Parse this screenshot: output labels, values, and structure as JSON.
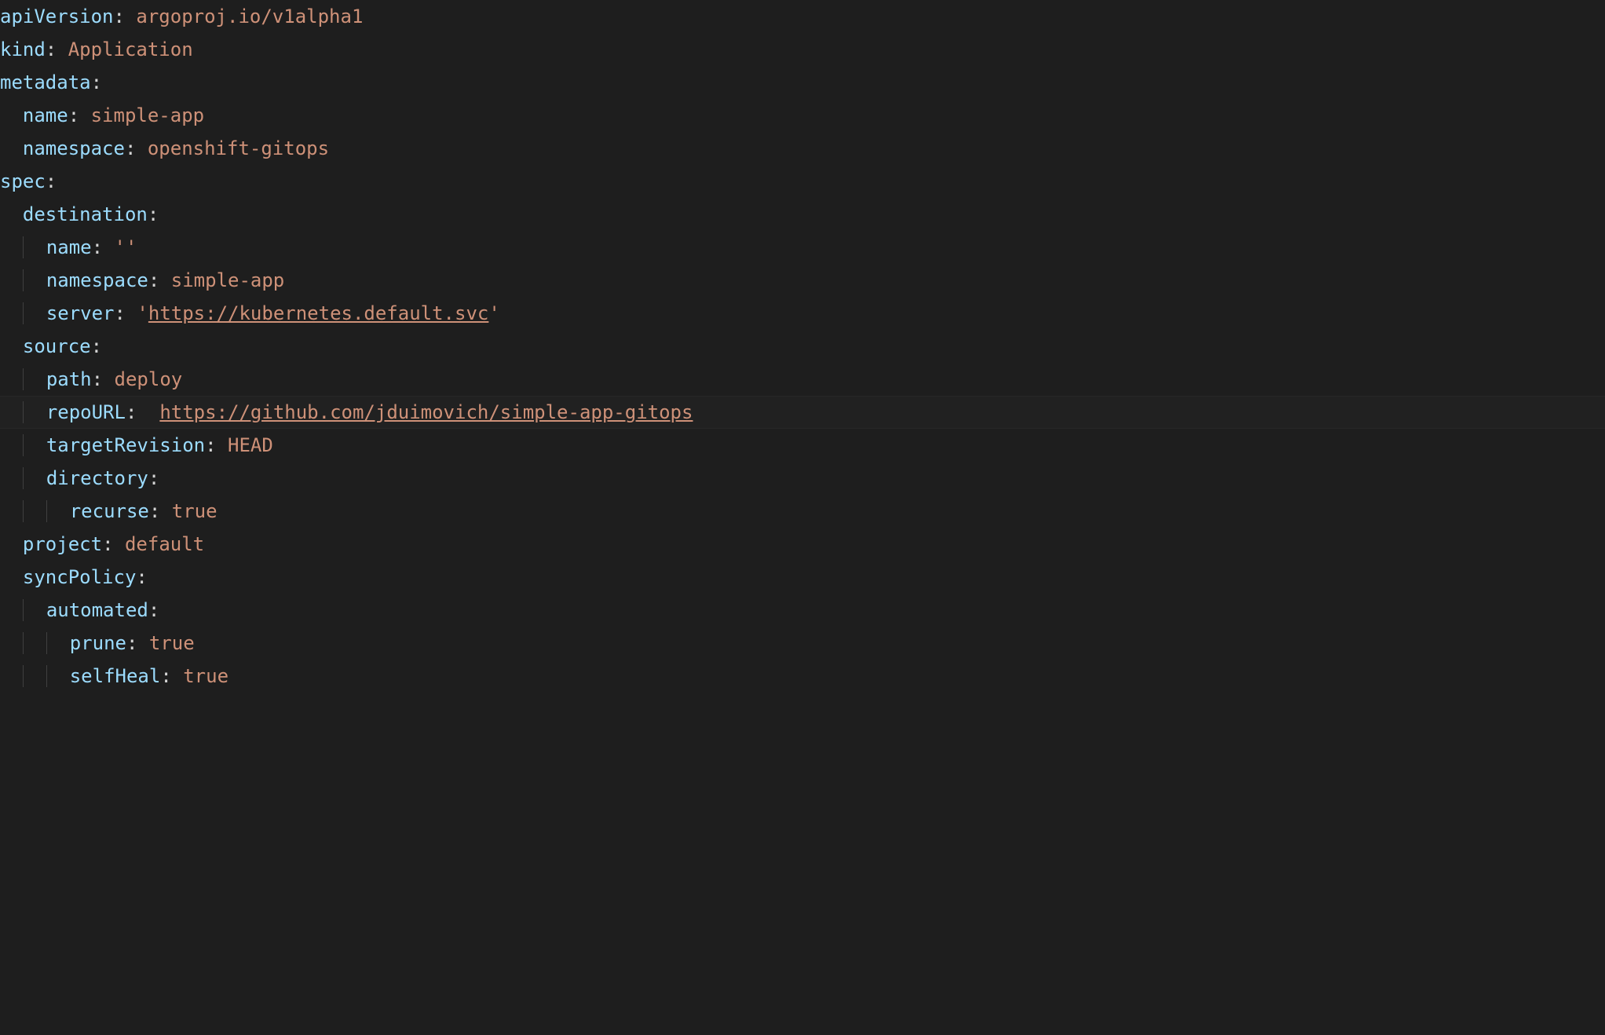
{
  "lines": {
    "l1": {
      "key": "apiVersion",
      "value": "argoproj.io/v1alpha1"
    },
    "l2": {
      "key": "kind",
      "value": "Application"
    },
    "l3": {
      "key": "metadata"
    },
    "l4": {
      "key": "name",
      "value": "simple-app"
    },
    "l5": {
      "key": "namespace",
      "value": "openshift-gitops"
    },
    "l6": {
      "key": "spec"
    },
    "l7": {
      "key": "destination"
    },
    "l8": {
      "key": "name",
      "quote1": "'",
      "value": "",
      "quote2": "'"
    },
    "l9": {
      "key": "namespace",
      "value": "simple-app"
    },
    "l10": {
      "key": "server",
      "quote1": "'",
      "value": "https://kubernetes.default.svc",
      "quote2": "'"
    },
    "l11": {
      "key": "source"
    },
    "l12": {
      "key": "path",
      "value": "deploy"
    },
    "l13": {
      "key": "repoURL",
      "value": "https://github.com/jduimovich/simple-app-gitops"
    },
    "l14": {
      "key": "targetRevision",
      "value": "HEAD"
    },
    "l15": {
      "key": "directory"
    },
    "l16": {
      "key": "recurse",
      "value": "true"
    },
    "l17": {
      "key": "project",
      "value": "default"
    },
    "l18": {
      "key": "syncPolicy"
    },
    "l19": {
      "key": "automated"
    },
    "l20": {
      "key": "prune",
      "value": "true"
    },
    "l21": {
      "key": "selfHeal",
      "value": "true"
    }
  }
}
